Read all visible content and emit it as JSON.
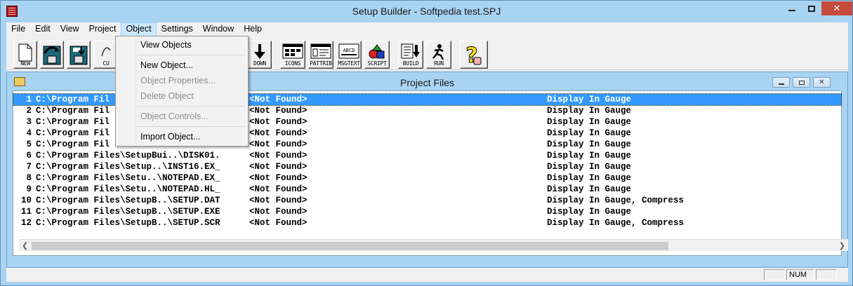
{
  "window": {
    "title": "Setup Builder - Softpedia test.SPJ",
    "close_label": "✕"
  },
  "menubar": {
    "items": [
      "File",
      "Edit",
      "View",
      "Project",
      "Object",
      "Settings",
      "Window",
      "Help"
    ],
    "open": "Object"
  },
  "toolbar": {
    "buttons": [
      {
        "label": "NEW",
        "icon": "new-document-icon"
      },
      {
        "label": "",
        "icon": "open-folder-icon"
      },
      {
        "label": "",
        "icon": "save-disk-icon"
      },
      {
        "label": "CU",
        "icon": "cut-icon"
      },
      {
        "label": "DOWN",
        "icon": "arrow-down-icon"
      },
      {
        "label": "ICONS",
        "icon": "icons-window-icon"
      },
      {
        "label": "PATTRIB",
        "icon": "pattrib-window-icon"
      },
      {
        "label": "MSGTEXT",
        "icon": "msgtext-window-icon"
      },
      {
        "label": "SCRIPT",
        "icon": "script-shapes-icon"
      },
      {
        "label": "BUILD",
        "icon": "build-icon"
      },
      {
        "label": "RUN",
        "icon": "run-icon"
      },
      {
        "label": "",
        "icon": "help-question-icon"
      }
    ],
    "msgtext_screen": "ABCD"
  },
  "object_menu": {
    "items": [
      {
        "label": "View Objects",
        "enabled": true
      },
      {
        "label": "New Object...",
        "enabled": true
      },
      {
        "label": "Object Properties...",
        "enabled": false
      },
      {
        "label": "Delete Object",
        "enabled": false
      },
      {
        "label": "Object Controls...",
        "enabled": false
      },
      {
        "label": "Import Object...",
        "enabled": true
      }
    ]
  },
  "project_files": {
    "title": "Project Files",
    "rows": [
      {
        "num": "1",
        "path": "C:\\Program Fil",
        "status": "<Not Found>",
        "options": "Display In Gauge",
        "selected": true
      },
      {
        "num": "2",
        "path": "C:\\Program Fil",
        "status": "<Not Found>",
        "options": "Display In Gauge"
      },
      {
        "num": "3",
        "path": "C:\\Program Fil",
        "status": "<Not Found>",
        "options": "Display In Gauge"
      },
      {
        "num": "4",
        "path": "C:\\Program Fil",
        "status": "<Not Found>",
        "options": "Display In Gauge"
      },
      {
        "num": "5",
        "path": "C:\\Program Fil",
        "status": "<Not Found>",
        "options": "Display In Gauge"
      },
      {
        "num": "6",
        "path": "C:\\Program Files\\SetupBui..\\DISK01.",
        "status": "<Not Found>",
        "options": "Display In Gauge"
      },
      {
        "num": "7",
        "path": "C:\\Program Files\\Setup..\\INST16.EX_",
        "status": "<Not Found>",
        "options": "Display In Gauge"
      },
      {
        "num": "8",
        "path": "C:\\Program Files\\Setu..\\NOTEPAD.EX_",
        "status": "<Not Found>",
        "options": "Display In Gauge"
      },
      {
        "num": "9",
        "path": "C:\\Program Files\\Setu..\\NOTEPAD.HL_",
        "status": "<Not Found>",
        "options": "Display In Gauge"
      },
      {
        "num": "10",
        "path": "C:\\Program Files\\SetupB..\\SETUP.DAT",
        "status": "<Not Found>",
        "options": "Display In Gauge, Compress"
      },
      {
        "num": "11",
        "path": "C:\\Program Files\\SetupB..\\SETUP.EXE",
        "status": "<Not Found>",
        "options": "Display In Gauge"
      },
      {
        "num": "12",
        "path": "C:\\Program Files\\SetupB..\\SETUP.SCR",
        "status": "<Not Found>",
        "options": "Display In Gauge, Compress"
      }
    ]
  },
  "statusbar": {
    "num_indicator": "NUM"
  },
  "colors": {
    "selection": "#3399ff",
    "frame": "#a9d3f2",
    "close_button": "#c74b3c"
  }
}
